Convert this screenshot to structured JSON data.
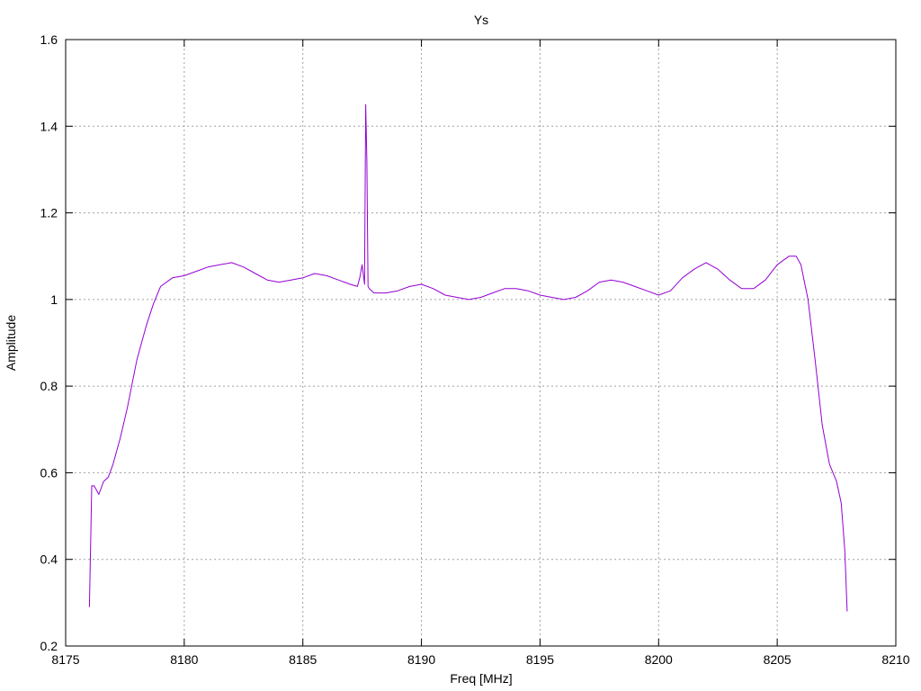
{
  "chart_data": {
    "type": "line",
    "title": "Ys",
    "xlabel": "Freq [MHz]",
    "ylabel": "Amplitude",
    "xlim": [
      8175,
      8210
    ],
    "ylim": [
      0.2,
      1.6
    ],
    "xticks": [
      8175,
      8180,
      8185,
      8190,
      8195,
      8200,
      8205,
      8210
    ],
    "xtick_labels": [
      "8175",
      "8180",
      "8185",
      "8190",
      "8195",
      "8200",
      "8205",
      "8210"
    ],
    "yticks": [
      0.2,
      0.4,
      0.6,
      0.8,
      1.0,
      1.2,
      1.4,
      1.6
    ],
    "ytick_labels": [
      "0.2",
      "0.4",
      "0.6",
      "0.8",
      "1",
      "1.2",
      "1.4",
      "1.6"
    ],
    "grid": true,
    "legend": "none",
    "series": [
      {
        "color": "#9400d3",
        "x": [
          8176.0,
          8176.1,
          8176.2,
          8176.3,
          8176.4,
          8176.6,
          8176.8,
          8177.0,
          8177.3,
          8177.6,
          8178.0,
          8178.4,
          8178.7,
          8179.0,
          8179.5,
          8180.0,
          8180.5,
          8181.0,
          8181.5,
          8182.0,
          8182.5,
          8183.0,
          8183.5,
          8184.0,
          8184.5,
          8185.0,
          8185.5,
          8186.0,
          8186.5,
          8187.0,
          8187.3,
          8187.4,
          8187.5,
          8187.6,
          8187.65,
          8187.7,
          8187.75,
          8187.8,
          8188.0,
          8188.5,
          8189.0,
          8189.5,
          8190.0,
          8190.5,
          8191.0,
          8191.5,
          8192.0,
          8192.5,
          8193.0,
          8193.5,
          8194.0,
          8194.5,
          8195.0,
          8195.5,
          8196.0,
          8196.5,
          8197.0,
          8197.5,
          8198.0,
          8198.5,
          8199.0,
          8199.5,
          8200.0,
          8200.5,
          8201.0,
          8201.5,
          8202.0,
          8202.5,
          8203.0,
          8203.5,
          8204.0,
          8204.5,
          8205.0,
          8205.5,
          8205.8,
          8206.0,
          8206.3,
          8206.6,
          8206.9,
          8207.2,
          8207.5,
          8207.7,
          8207.85,
          8207.95
        ],
        "y": [
          0.29,
          0.57,
          0.57,
          0.56,
          0.55,
          0.58,
          0.59,
          0.62,
          0.68,
          0.75,
          0.86,
          0.94,
          0.99,
          1.03,
          1.05,
          1.055,
          1.065,
          1.075,
          1.08,
          1.085,
          1.075,
          1.06,
          1.045,
          1.04,
          1.045,
          1.05,
          1.06,
          1.055,
          1.045,
          1.035,
          1.03,
          1.05,
          1.08,
          1.035,
          1.45,
          1.32,
          1.03,
          1.025,
          1.015,
          1.015,
          1.02,
          1.03,
          1.035,
          1.025,
          1.01,
          1.005,
          1.0,
          1.005,
          1.015,
          1.025,
          1.025,
          1.02,
          1.01,
          1.005,
          1.0,
          1.005,
          1.02,
          1.04,
          1.045,
          1.04,
          1.03,
          1.02,
          1.01,
          1.02,
          1.05,
          1.07,
          1.085,
          1.07,
          1.045,
          1.025,
          1.025,
          1.045,
          1.08,
          1.1,
          1.1,
          1.08,
          1.0,
          0.86,
          0.71,
          0.62,
          0.58,
          0.53,
          0.42,
          0.28
        ]
      }
    ]
  }
}
